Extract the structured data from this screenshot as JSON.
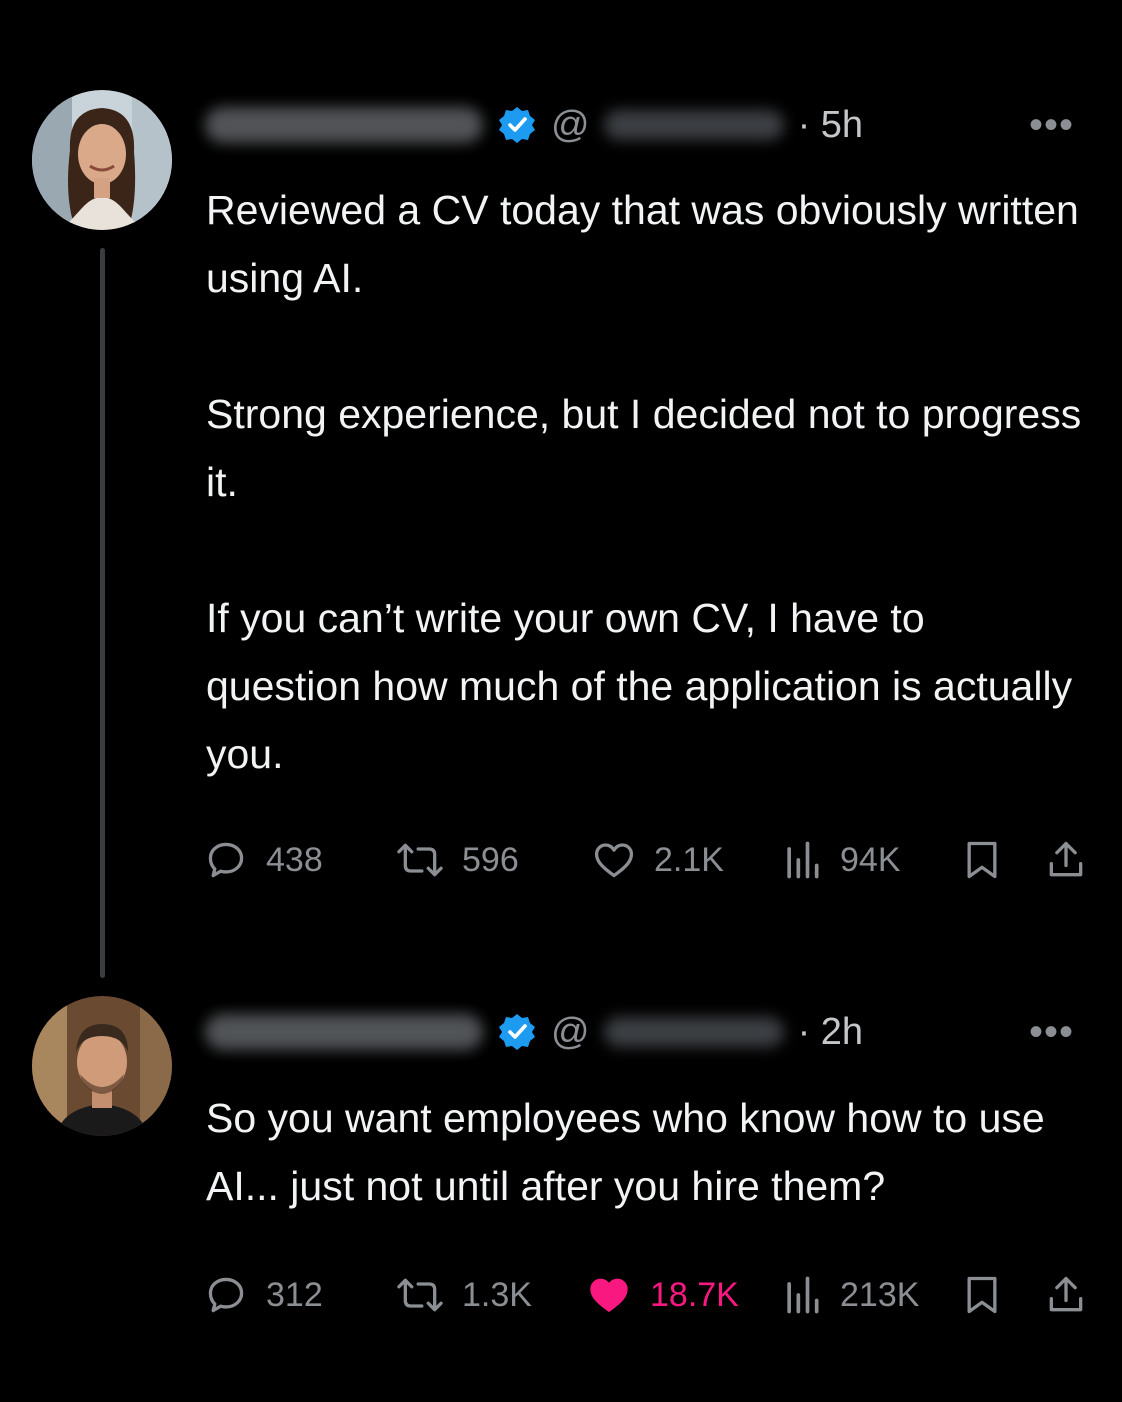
{
  "posts": [
    {
      "time": "· 5h",
      "at": "@",
      "more": "•••",
      "paragraphs": [
        "Reviewed a CV today that was obviously written using AI.",
        "Strong experience, but I decided not to progress it.",
        "If you can’t write your own CV, I have to question how much of the application is actually you."
      ],
      "stats": {
        "replies": "438",
        "reposts": "596",
        "likes": "2.1K",
        "views": "94K"
      },
      "liked": false
    },
    {
      "time": "· 2h",
      "at": "@",
      "more": "•••",
      "paragraphs": [
        "So you want employees who know how to use AI... just not until after you hire them?"
      ],
      "stats": {
        "replies": "312",
        "reposts": "1.3K",
        "likes": "18.7K",
        "views": "213K"
      },
      "liked": true,
      "like_color": "#f91880"
    }
  ],
  "colors": {
    "background": "#000000",
    "text": "#f1f3f4",
    "muted": "#8b8f94",
    "verified": "#1d9bf0"
  }
}
